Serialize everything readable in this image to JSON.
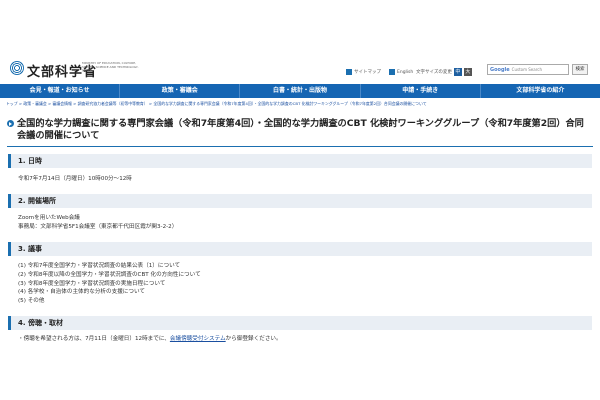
{
  "header": {
    "logo_text": "文部科学省",
    "logo_sub": "MINISTRY OF EDUCATION, CULTURE, SPORTS, SCIENCE AND TECHNOLOGY-JAPAN",
    "sitemap": "サイトマップ",
    "english": "English",
    "font_size_label": "文字サイズの変更",
    "font_size_a": "中",
    "font_size_b": "大",
    "search_placeholder": "Custom Search",
    "search_google": "Google",
    "search_button": "検索"
  },
  "nav": {
    "items": [
      {
        "label": "会見・報道・お知らせ"
      },
      {
        "label": "政策・審議会"
      },
      {
        "label": "白書・統計・出版物"
      },
      {
        "label": "申請・手続き"
      },
      {
        "label": "文部科学省の紹介"
      }
    ]
  },
  "breadcrumb": {
    "prefix": "トップ > 政策・審議会 > ",
    "text": "審議会情報 > 調査研究協力者会議等（初等中等教育） > 全国的な学力調査に関する専門家会議（令和7年度第4回）・全国的な学力調査のCBT 化検討ワーキンググループ（令和7年度第2回）合同会議の開催について"
  },
  "page": {
    "title": "全国的な学力調査に関する専門家会議（令和7年度第4回）・全国的な学力調査のCBT 化検討ワーキンググループ（令和7年度第2回）合同会議の開催について"
  },
  "sections": [
    {
      "heading": "1. 日時",
      "lines": [
        "令和7年7月14日（月曜日）10時00分～12時"
      ]
    },
    {
      "heading": "2. 開催場所",
      "lines": [
        "Zoomを用いたWeb会議",
        "事務局：文部科学省5F1会議室（東京都千代田区霞が関3-2-2）"
      ]
    },
    {
      "heading": "3. 議事",
      "lines": [
        "(1) 令和7年度全国学力・学習状況調査の結果公表（1）について",
        "(2) 令和8年度以降の全国学力・学習状況調査のCBT 化の方向性について",
        "(3) 令和8年度全国学力・学習状況調査の実施日程について",
        "(4) 各学校・自治体の主体的な分析の支援について",
        "(5) その他"
      ]
    },
    {
      "heading": "4. 傍聴・取材",
      "lines_prefix": "・傍聴を希望される方は、7月11日（金曜日）12時までに、",
      "lines_link": "会議傍聴受付システム",
      "lines_suffix": "から御登録ください。"
    }
  ]
}
